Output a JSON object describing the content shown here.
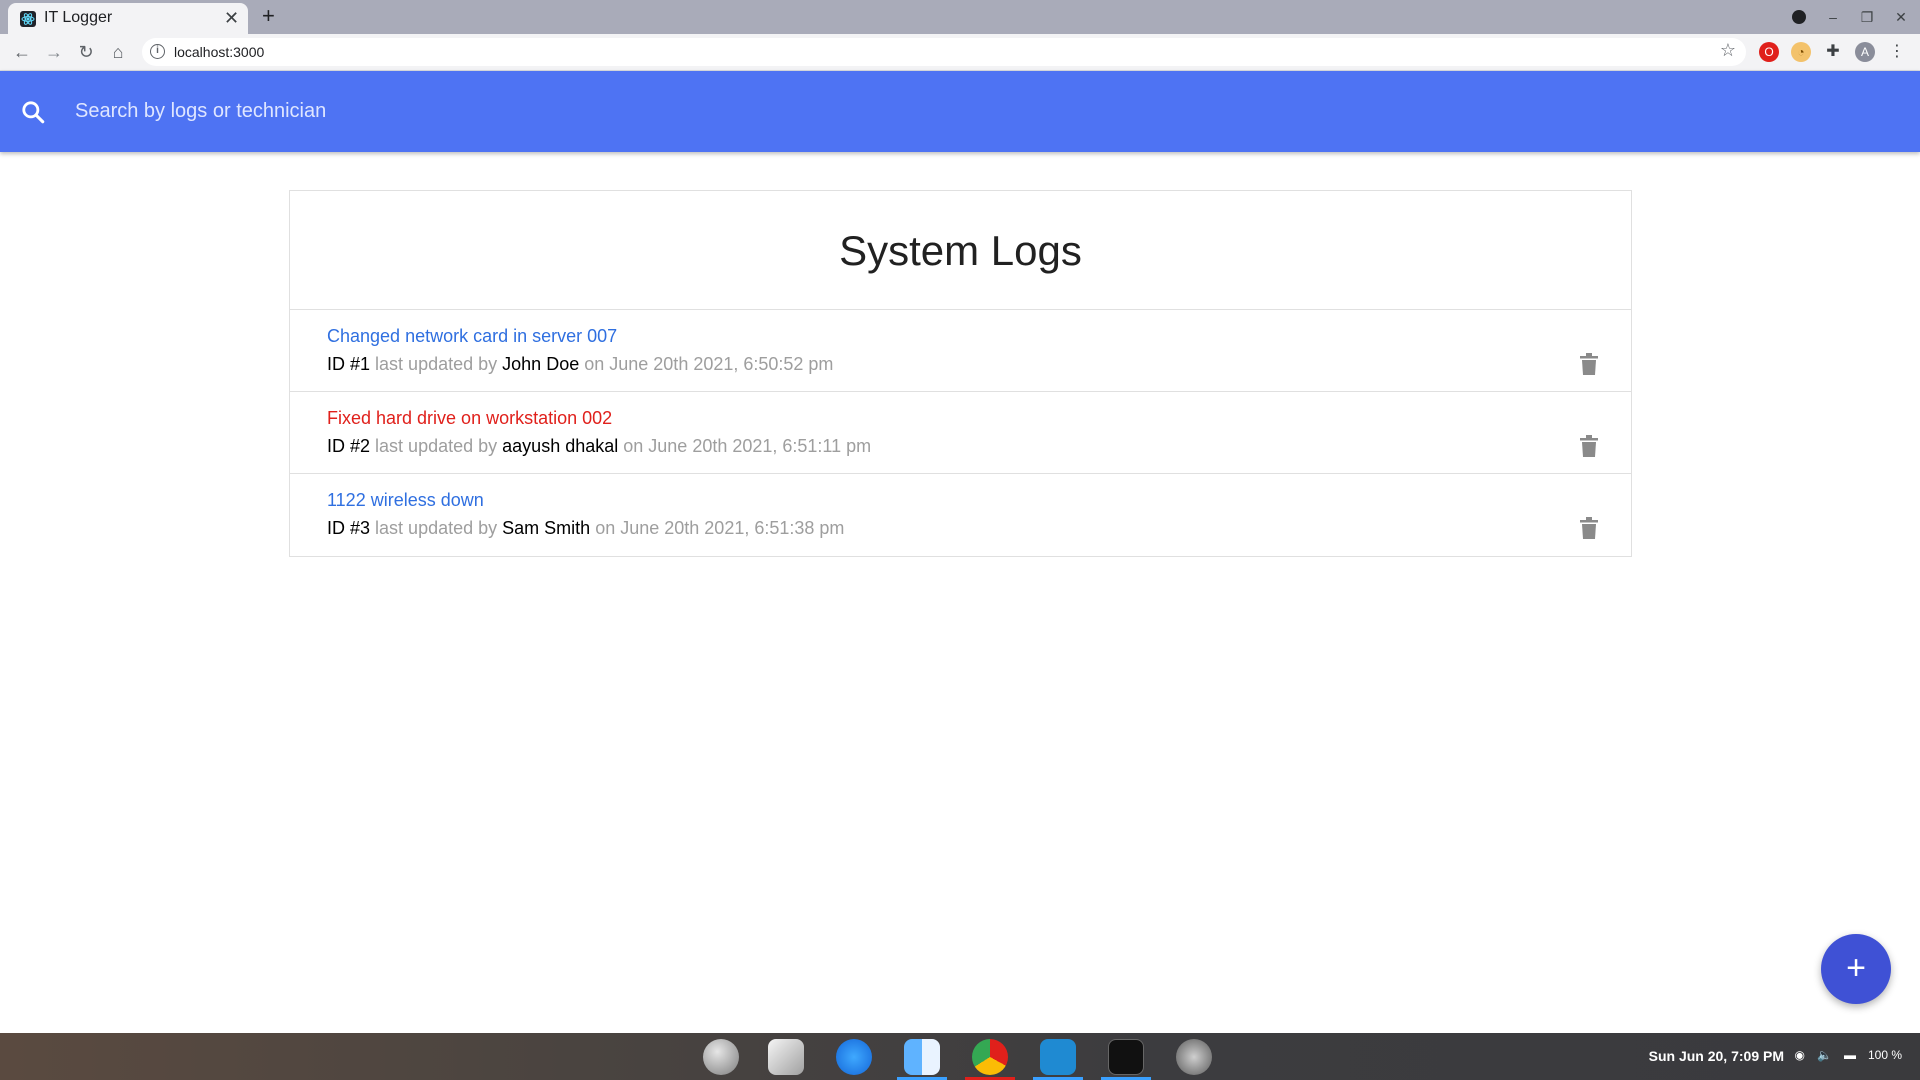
{
  "browser": {
    "tab_title": "IT Logger",
    "tab_close": "✕",
    "new_tab": "+",
    "url": "localhost:3000",
    "profile_initial": "A"
  },
  "navbar": {
    "search_placeholder": "Search by logs or technician",
    "color": "#4e73f3"
  },
  "main": {
    "title": "System Logs",
    "logs": [
      {
        "message": "Changed network card in server 007",
        "id_label": "ID #1",
        "updated_by_text": "last updated by",
        "tech": "John Doe",
        "date_text": "on June 20th 2021, 6:50:52 pm",
        "attention": false,
        "color": "#2f6fe0"
      },
      {
        "message": "Fixed hard drive on workstation 002",
        "id_label": "ID #2",
        "updated_by_text": "last updated by",
        "tech": "aayush dhakal",
        "date_text": "on June 20th 2021, 6:51:11 pm",
        "attention": true,
        "color": "#e0201b"
      },
      {
        "message": "1122 wireless down",
        "id_label": "ID #3",
        "updated_by_text": "last updated by",
        "tech": "Sam Smith",
        "date_text": "on June 20th 2021, 6:51:38 pm",
        "attention": false,
        "color": "#2f6fe0"
      }
    ]
  },
  "fab": {
    "label": "+",
    "color": "#3f51d5"
  },
  "taskbar": {
    "clock": "Sun Jun 20,  7:09 PM",
    "battery": "100 %",
    "apps": [
      "launcher-icon",
      "inkscape-icon",
      "app-store-icon",
      "finder-icon",
      "chrome-icon",
      "vscode-icon",
      "terminal-icon",
      "settings-icon"
    ]
  }
}
